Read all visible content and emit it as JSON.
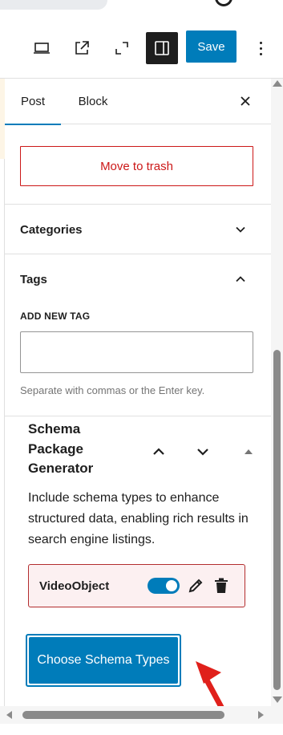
{
  "toolbar": {
    "icons": [
      "laptop-icon",
      "external-link-icon",
      "fullscreen-icon",
      "sidebar-icon"
    ],
    "save_label": "Save",
    "more_icon": "more-vertical-icon"
  },
  "tabs": {
    "post_label": "Post",
    "block_label": "Block",
    "close_icon": "close-icon"
  },
  "trash": {
    "label": "Move to trash"
  },
  "panels": {
    "categories": {
      "title": "Categories",
      "expanded": false
    },
    "tags": {
      "title": "Tags",
      "expanded": true,
      "field_label": "ADD NEW TAG",
      "input_value": "",
      "help_text": "Separate with commas or the Enter key."
    }
  },
  "schema": {
    "title": "Schema Package Generator",
    "description": "Include schema types to enhance structured data, enabling rich results in search engine listings.",
    "items": [
      {
        "label": "VideoObject",
        "enabled": true
      }
    ],
    "choose_label": "Choose Schema Types"
  },
  "colors": {
    "accent": "#007cba",
    "danger": "#cc1818",
    "annotation": "#e0201b"
  }
}
